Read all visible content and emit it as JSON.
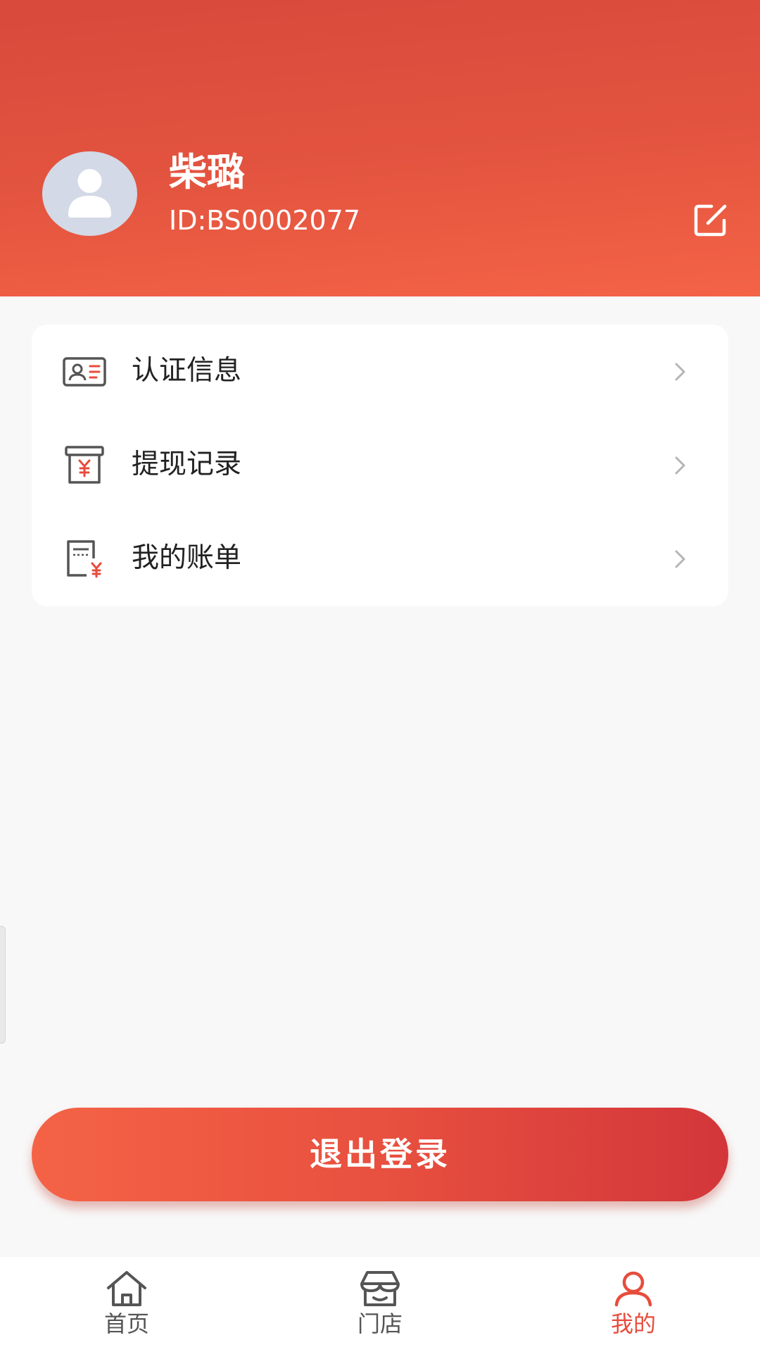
{
  "profile": {
    "name": "柴璐",
    "id_text": "ID:BS0002077"
  },
  "menu": {
    "items": [
      {
        "label": "认证信息",
        "icon": "id-card-icon"
      },
      {
        "label": "提现记录",
        "icon": "withdraw-icon"
      },
      {
        "label": "我的账单",
        "icon": "bill-icon"
      }
    ]
  },
  "logout": {
    "label": "退出登录"
  },
  "tabbar": {
    "items": [
      {
        "label": "首页",
        "icon": "home-icon",
        "active": false
      },
      {
        "label": "门店",
        "icon": "store-icon",
        "active": false
      },
      {
        "label": "我的",
        "icon": "user-icon",
        "active": true
      }
    ]
  },
  "colors": {
    "accent": "#e74c3c",
    "header_top": "#d9493c",
    "header_bottom": "#f46346",
    "background": "#f8f8f8"
  }
}
